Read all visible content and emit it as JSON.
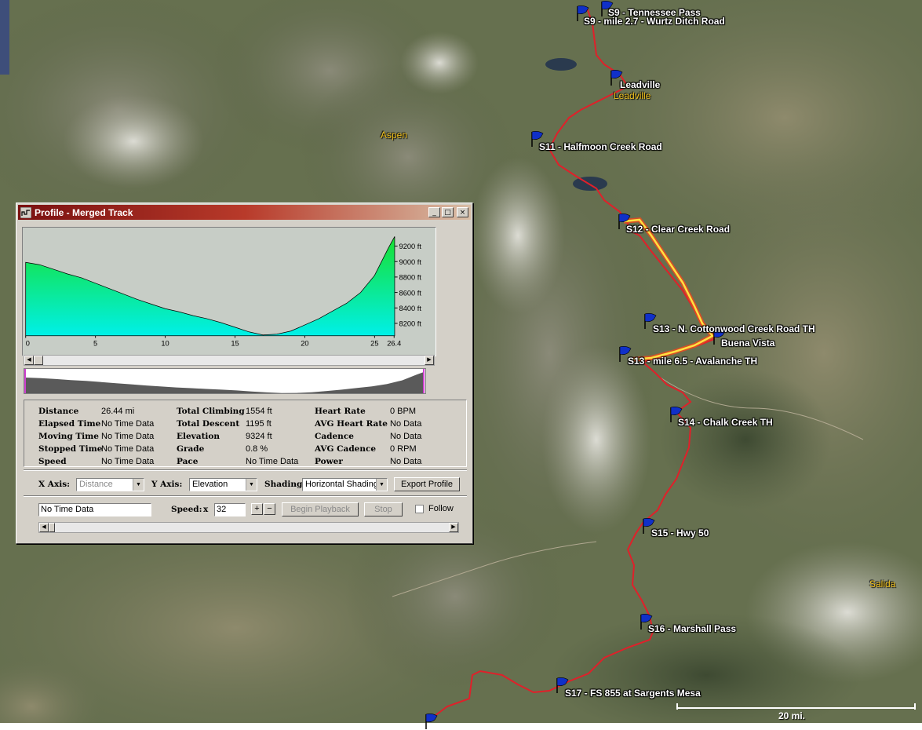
{
  "map": {
    "waypoints": [
      {
        "label": "S9 - Tennessee Pass"
      },
      {
        "label": "S9 - mile 2.7 - Wurtz Ditch Road"
      },
      {
        "label": "Leadville"
      },
      {
        "label": "S11 - Halfmoon Creek Road"
      },
      {
        "label": "S12 - Clear Creek Road"
      },
      {
        "label": "S13 - N. Cottonwood Creek Road TH"
      },
      {
        "label": "Buena Vista"
      },
      {
        "label": "S13 - mile 6.5 - Avalanche TH"
      },
      {
        "label": "S14 - Chalk Creek TH"
      },
      {
        "label": "S15 - Hwy 50"
      },
      {
        "label": "S16 - Marshall Pass"
      },
      {
        "label": "S17 - FS 855 at Sargents Mesa"
      }
    ],
    "cities": [
      "Leadville",
      "Aspen",
      "Salida"
    ],
    "scale_label": "20 mi.",
    "colors": {
      "track": "#e0202a",
      "highlight": "#ffe040",
      "city_label": "#f2c21e",
      "flag": "#1030c8"
    }
  },
  "window": {
    "title": "Profile - Merged Track",
    "controls": {
      "minimize": "_",
      "maximize": "□",
      "close": "×"
    }
  },
  "chart_data": {
    "type": "area",
    "x": [
      0,
      1,
      2,
      3,
      4,
      5,
      6,
      7,
      8,
      9,
      10,
      11,
      12,
      13,
      14,
      15,
      16,
      17,
      18,
      19,
      20,
      21,
      22,
      23,
      24,
      25,
      26,
      26.44
    ],
    "y": [
      8990,
      8960,
      8900,
      8840,
      8790,
      8720,
      8650,
      8580,
      8510,
      8450,
      8390,
      8350,
      8300,
      8260,
      8210,
      8150,
      8090,
      8050,
      8060,
      8100,
      8180,
      8260,
      8360,
      8460,
      8600,
      8820,
      9180,
      9324
    ],
    "xlim": [
      0,
      26.44
    ],
    "ylim": [
      8040,
      9324
    ],
    "x_ticks": [
      "0",
      "5",
      "10",
      "15",
      "20",
      "25",
      "26.4"
    ],
    "x_tick_values": [
      0,
      5,
      10,
      15,
      20,
      25,
      26.4
    ],
    "y_ticks": [
      "9200 ft",
      "9000 ft",
      "8800 ft",
      "8600 ft",
      "8400 ft",
      "8200 ft"
    ],
    "y_tick_values": [
      9200,
      9000,
      8800,
      8600,
      8400,
      8200
    ],
    "grid": false,
    "shading": "horizontal gradient green to cyan",
    "colors": {
      "top": "#18e030",
      "bottom": "#00f0e8",
      "background": "#c7cdc6"
    }
  },
  "stats": {
    "col1": [
      {
        "label": "Distance",
        "value": "26.44 mi"
      },
      {
        "label": "Elapsed Time",
        "value": "No Time Data"
      },
      {
        "label": "Moving Time",
        "value": "No Time Data"
      },
      {
        "label": "Stopped Time",
        "value": "No Time Data"
      },
      {
        "label": "Speed",
        "value": "No Time Data"
      }
    ],
    "col2": [
      {
        "label": "Total Climbing",
        "value": "1554 ft"
      },
      {
        "label": "Total Descent",
        "value": "1195 ft"
      },
      {
        "label": "Elevation",
        "value": "9324 ft"
      },
      {
        "label": "Grade",
        "value": "0.8 %"
      },
      {
        "label": "Pace",
        "value": "No Time Data"
      }
    ],
    "col3": [
      {
        "label": "Heart Rate",
        "value": "0 BPM"
      },
      {
        "label": "AVG Heart Rate",
        "value": "No Data"
      },
      {
        "label": "Cadence",
        "value": "No Data"
      },
      {
        "label": "AVG Cadence",
        "value": "0 RPM"
      },
      {
        "label": "Power",
        "value": "No Data"
      }
    ]
  },
  "axes_controls": {
    "x_axis_label": "X Axis:",
    "x_axis_value": "Distance",
    "y_axis_label": "Y Axis:",
    "y_axis_value": "Elevation",
    "shading_label": "Shading:",
    "shading_value": "Horizontal Shading",
    "export_label": "Export Profile"
  },
  "playback": {
    "time_value": "No Time Data",
    "speed_label": "Speed:",
    "speed_x": "x",
    "speed_value": "32",
    "plus": "+",
    "minus": "−",
    "begin_label": "Begin Playback",
    "stop_label": "Stop",
    "follow_label": "Follow"
  }
}
